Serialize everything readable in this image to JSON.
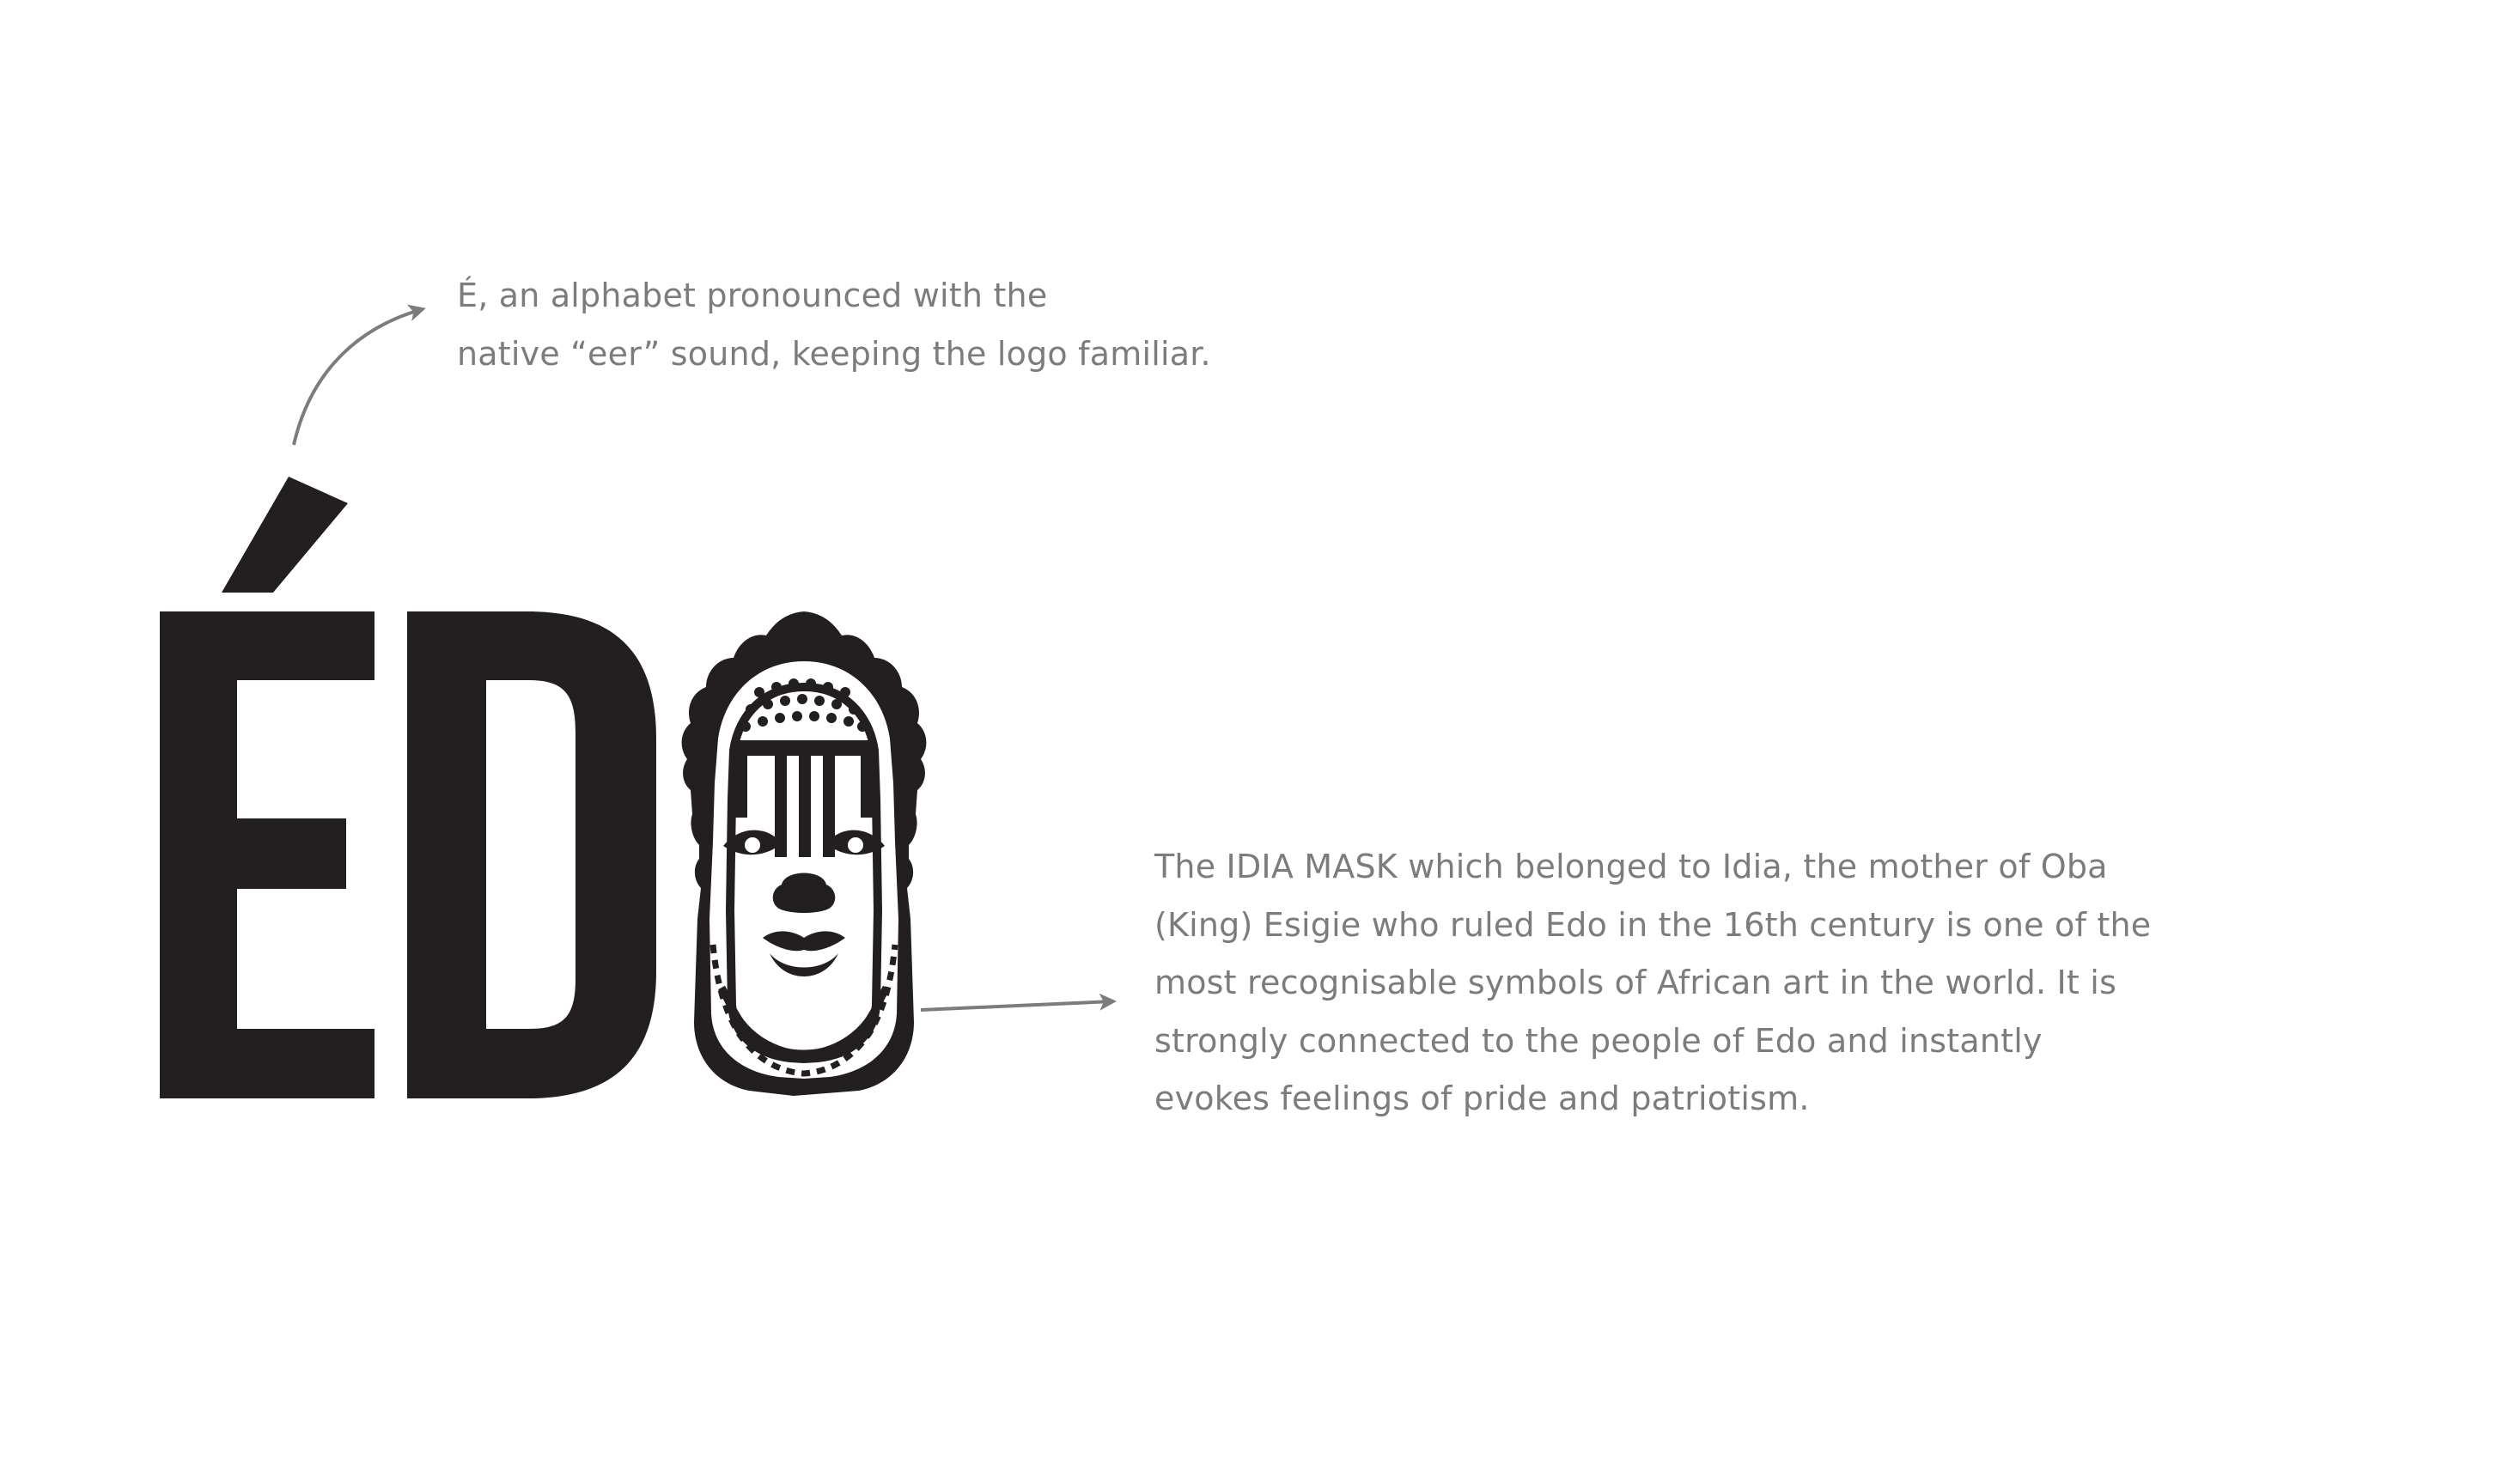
{
  "logo": {
    "wordmark": "ÉDO",
    "mark_icon": "idia-mask-icon",
    "ink_color": "#231f20"
  },
  "annotations": {
    "accent_note": {
      "lines": [
        "É, an alphabet pronounced with the",
        "native “eer” sound, keeping the logo familiar."
      ]
    },
    "mask_note": {
      "lines": [
        "The IDIA MASK which belonged to Idia, the mother of Oba",
        "(King) Esigie who ruled Edo in the 16th century is one of the",
        "most recognisable symbols of African art in the world. It is",
        "strongly connected to the people of Edo and instantly",
        "evokes feelings of pride and patriotism."
      ]
    }
  },
  "colors": {
    "background": "#ffffff",
    "logo_ink": "#231f20",
    "annotation_text": "#7c7c7c",
    "arrow": "#7c7c7c"
  }
}
